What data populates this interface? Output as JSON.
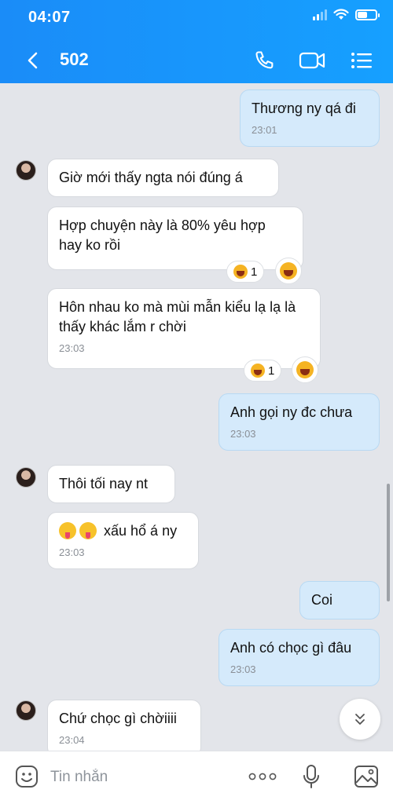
{
  "status_bar": {
    "time": "04:07"
  },
  "header": {
    "title": "502",
    "back_icon": "chevron-left-icon",
    "call_icon": "phone-icon",
    "video_icon": "video-camera-icon",
    "menu_icon": "list-menu-icon",
    "color": "#1a8cf8"
  },
  "messages": [
    {
      "dir": "out",
      "text": "Thương ny qá đi",
      "time": "23:01"
    },
    {
      "dir": "in",
      "text": "Giờ mới thấy ngta nói đúng á",
      "time": ""
    },
    {
      "dir": "in",
      "text": "Hợp chuyện này là 80% yêu hợp hay ko rồi",
      "time": "",
      "reaction_count": "1"
    },
    {
      "dir": "in",
      "text": "Hôn nhau ko mà mùi mẫn kiểu lạ lạ là thấy khác lắm r chời",
      "time": "23:03",
      "reaction_count": "1"
    },
    {
      "dir": "out",
      "text": "Anh gọi ny đc chưa",
      "time": "23:03"
    },
    {
      "dir": "in",
      "text": "Thôi tối nay nt",
      "time": ""
    },
    {
      "dir": "in",
      "text": "xấu hổ á ny",
      "time": "23:03"
    },
    {
      "dir": "out",
      "text": "Coi",
      "time": ""
    },
    {
      "dir": "out",
      "text": "Anh có chọc gì đâu",
      "time": "23:03"
    },
    {
      "dir": "in",
      "text": "Chứ chọc gì chờiiii",
      "time": "23:04"
    }
  ],
  "input": {
    "placeholder": "Tin nhắn",
    "sticker_icon": "sticker-face-icon",
    "more_icon": "more-dots-icon",
    "mic_icon": "microphone-icon",
    "image_icon": "image-icon"
  },
  "colors": {
    "outgoing_bubble": "#d5eafb",
    "incoming_bubble": "#ffffff",
    "background": "#e3e5ea"
  }
}
